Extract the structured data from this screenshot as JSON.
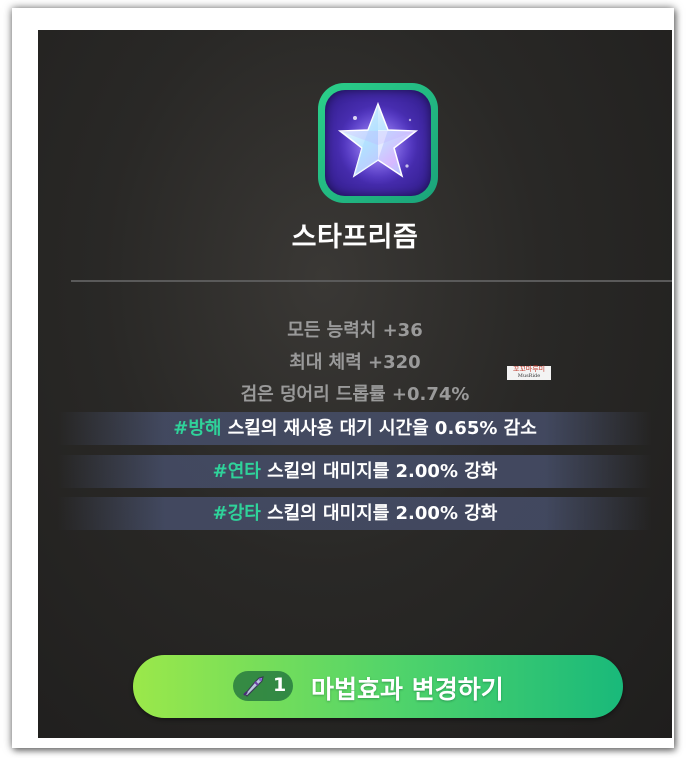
{
  "item": {
    "name": "스타프리즘",
    "icon": "star-prism-icon"
  },
  "stats": [
    "모든 능력치 +36",
    "최대 체력 +320",
    "검은 덩어리 드롭률 +0.74%"
  ],
  "effects": [
    {
      "tag": "#방해",
      "text": " 스킬의 재사용 대기 시간을 0.65% 감소"
    },
    {
      "tag": "#연타",
      "text": " 스킬의 대미지를 2.00% 강화"
    },
    {
      "tag": "#강타",
      "text": " 스킬의 대미지를 2.00% 강화"
    }
  ],
  "watermark": {
    "text": "꼬꼬마루미",
    "sub": "MusRide"
  },
  "button": {
    "cost_count": "1",
    "cost_icon": "enchant-scroll-icon",
    "label": "마법효과 변경하기"
  },
  "colors": {
    "tag": "#2fd29a",
    "button_start": "#9be84a",
    "button_end": "#19b97a",
    "icon_frame": "#2bd08a"
  }
}
